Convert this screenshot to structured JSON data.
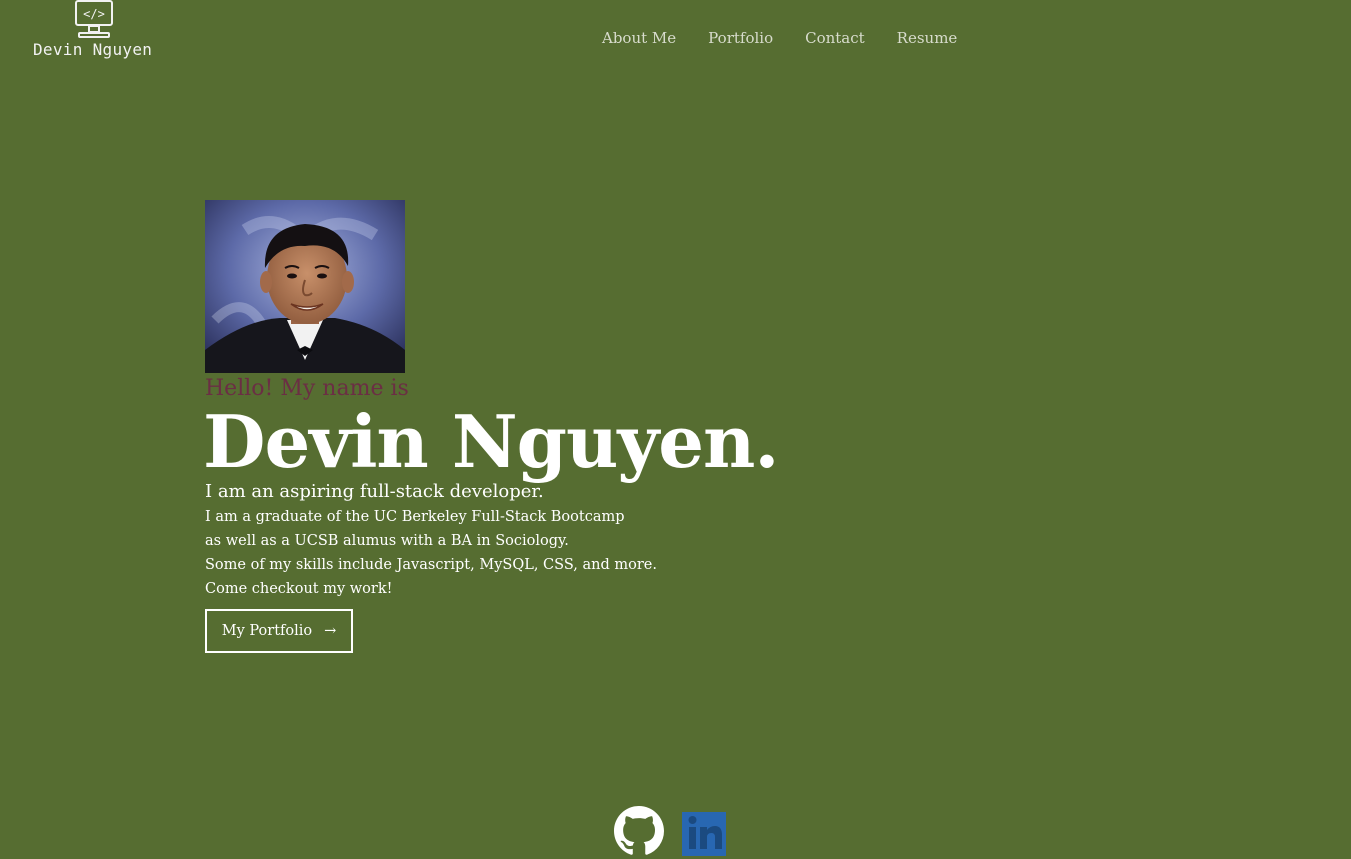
{
  "header": {
    "logo_text": "Devin Nguyen",
    "logo_icon": "monitor-code-icon",
    "nav": [
      {
        "label": "About Me"
      },
      {
        "label": "Portfolio"
      },
      {
        "label": "Contact"
      },
      {
        "label": "Resume"
      }
    ]
  },
  "hero": {
    "portrait_alt": "portrait-photo",
    "greeting": "Hello! My name is",
    "name": "Devin Nguyen.",
    "tagline": "I am an aspiring full-stack developer.",
    "bio_lines": [
      "I am a graduate of the UC Berkeley Full-Stack Bootcamp",
      "as well as a UCSB alumus with a BA in Sociology.",
      "Some of my skills include Javascript, MySQL, CSS, and more.",
      "Come checkout my work!"
    ],
    "cta_label": "My Portfolio",
    "cta_arrow": "→"
  },
  "social": {
    "github_icon": "github-icon",
    "linkedin_icon": "linkedin-icon"
  },
  "colors": {
    "background": "#566d31",
    "greeting": "#6b2e44",
    "text": "#ffffff",
    "nav": "#d8dccd",
    "linkedin": "#2867b2"
  }
}
